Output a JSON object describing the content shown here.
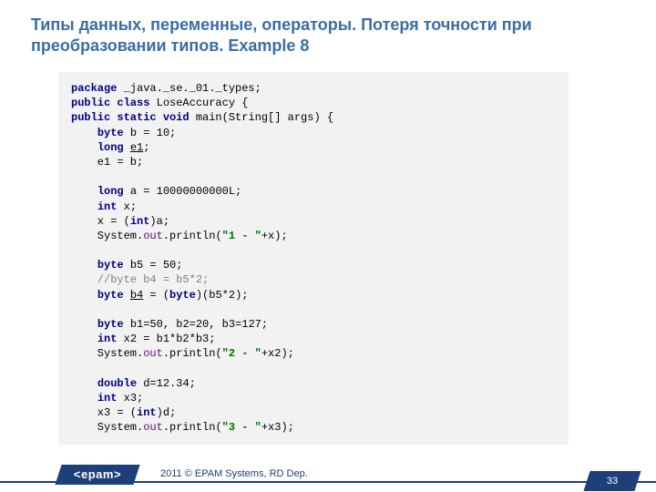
{
  "title": "Типы данных, переменные, операторы. Потеря точности при преобразовании типов. Example 8",
  "code": {
    "tokens": [
      [
        [
          "kw",
          "package "
        ],
        [
          "pl",
          "_java._se._01._types;"
        ]
      ],
      [
        [
          "kw",
          "public class "
        ],
        [
          "pl",
          "LoseAccuracy {"
        ]
      ],
      [
        [
          "kw",
          "public static void "
        ],
        [
          "pl",
          "main(String[] args) {"
        ]
      ],
      [
        [
          "pl",
          "    "
        ],
        [
          "kw",
          "byte "
        ],
        [
          "pl",
          "b = 10;"
        ]
      ],
      [
        [
          "pl",
          "    "
        ],
        [
          "kw",
          "long "
        ],
        [
          "ul",
          "e1"
        ],
        [
          "pl",
          ";"
        ]
      ],
      [
        [
          "pl",
          "    e1 = b;"
        ]
      ],
      [
        [
          "pl",
          ""
        ]
      ],
      [
        [
          "pl",
          "    "
        ],
        [
          "kw",
          "long "
        ],
        [
          "pl",
          "a = 10000000000L;"
        ]
      ],
      [
        [
          "pl",
          "    "
        ],
        [
          "kw",
          "int "
        ],
        [
          "pl",
          "x;"
        ]
      ],
      [
        [
          "pl",
          "    x = ("
        ],
        [
          "kw",
          "int"
        ],
        [
          "pl",
          ")a;"
        ]
      ],
      [
        [
          "pl",
          "    System."
        ],
        [
          "fld",
          "out"
        ],
        [
          "pl",
          ".println("
        ],
        [
          "str",
          "\"1 - \""
        ],
        [
          "pl",
          "+x);"
        ]
      ],
      [
        [
          "pl",
          ""
        ]
      ],
      [
        [
          "pl",
          "    "
        ],
        [
          "kw",
          "byte "
        ],
        [
          "pl",
          "b5 = 50;"
        ]
      ],
      [
        [
          "pl",
          "    "
        ],
        [
          "cmt",
          "//byte b4 = b5*2;"
        ]
      ],
      [
        [
          "pl",
          "    "
        ],
        [
          "kw",
          "byte "
        ],
        [
          "ul",
          "b4"
        ],
        [
          "pl",
          " = ("
        ],
        [
          "kw",
          "byte"
        ],
        [
          "pl",
          ")(b5*2);"
        ]
      ],
      [
        [
          "pl",
          ""
        ]
      ],
      [
        [
          "pl",
          "    "
        ],
        [
          "kw",
          "byte "
        ],
        [
          "pl",
          "b1=50, b2=20, b3=127;"
        ]
      ],
      [
        [
          "pl",
          "    "
        ],
        [
          "kw",
          "int "
        ],
        [
          "pl",
          "x2 = b1*b2*b3;"
        ]
      ],
      [
        [
          "pl",
          "    System."
        ],
        [
          "fld",
          "out"
        ],
        [
          "pl",
          ".println("
        ],
        [
          "str",
          "\"2 - \""
        ],
        [
          "pl",
          "+x2);"
        ]
      ],
      [
        [
          "pl",
          ""
        ]
      ],
      [
        [
          "pl",
          "    "
        ],
        [
          "kw",
          "double "
        ],
        [
          "pl",
          "d=12.34;"
        ]
      ],
      [
        [
          "pl",
          "    "
        ],
        [
          "kw",
          "int "
        ],
        [
          "pl",
          "x3;"
        ]
      ],
      [
        [
          "pl",
          "    x3 = ("
        ],
        [
          "kw",
          "int"
        ],
        [
          "pl",
          ")d;"
        ]
      ],
      [
        [
          "pl",
          "    System."
        ],
        [
          "fld",
          "out"
        ],
        [
          "pl",
          ".println("
        ],
        [
          "str",
          "\"3 - \""
        ],
        [
          "pl",
          "+x3);"
        ]
      ]
    ]
  },
  "footer": {
    "logo": "<epam>",
    "copyright": "2011 © EPAM Systems, RD Dep.",
    "page": "33"
  }
}
